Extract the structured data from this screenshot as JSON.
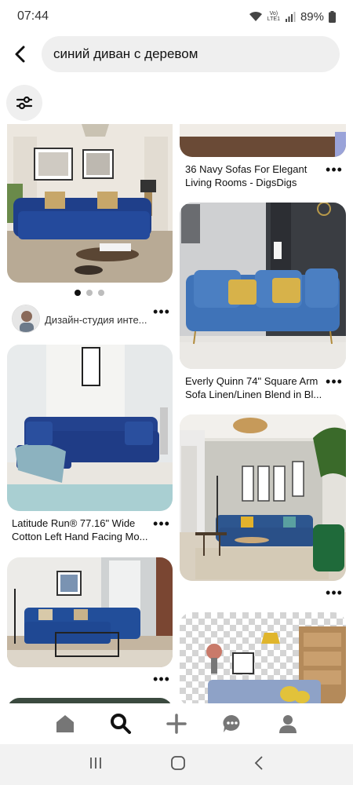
{
  "status": {
    "time": "07:44",
    "volte_top": "Vo)",
    "volte_bottom": "LTE1",
    "battery": "89%"
  },
  "search": {
    "query": "синий диван с деревом",
    "back_icon": "chevron-left-icon",
    "filter_icon": "sliders-icon"
  },
  "feed": {
    "left": [
      {
        "id": "pin-l1",
        "kind": "tufted navy sofa living room",
        "carousel_pages": 3,
        "carousel_active": 1,
        "creator": "Дизайн-студия инте..."
      },
      {
        "id": "pin-l2",
        "title_line1": "Latitude Run® 77.16\" Wide",
        "title_line2": "Cotton Left Hand Facing Mo..."
      },
      {
        "id": "pin-l3",
        "kind": "blue sectional room"
      }
    ],
    "right": [
      {
        "id": "pin-r1",
        "title_line1": "36 Navy Sofas For Elegant",
        "title_line2": "Living Rooms - DigsDigs"
      },
      {
        "id": "pin-r2",
        "title_line1": "Everly Quinn 74\" Square Arm",
        "title_line2": "Sofa Linen/Linen Blend in Bl..."
      },
      {
        "id": "pin-r3",
        "kind": "blue sofa with green chair"
      },
      {
        "id": "pin-r4",
        "kind": "transparent background sofa"
      }
    ],
    "more_label": "•••"
  },
  "nav": {
    "items": [
      "home-icon",
      "search-icon",
      "plus-icon",
      "messages-icon",
      "profile-icon"
    ],
    "active": "search-icon"
  },
  "system_nav": [
    "recent-apps-icon",
    "home-circle-icon",
    "back-icon"
  ],
  "colors": {
    "pill_bg": "#efefef",
    "sofa_blue": "#2c4f8c",
    "sofa_light_blue": "#3f6ea8",
    "text": "#111111"
  }
}
